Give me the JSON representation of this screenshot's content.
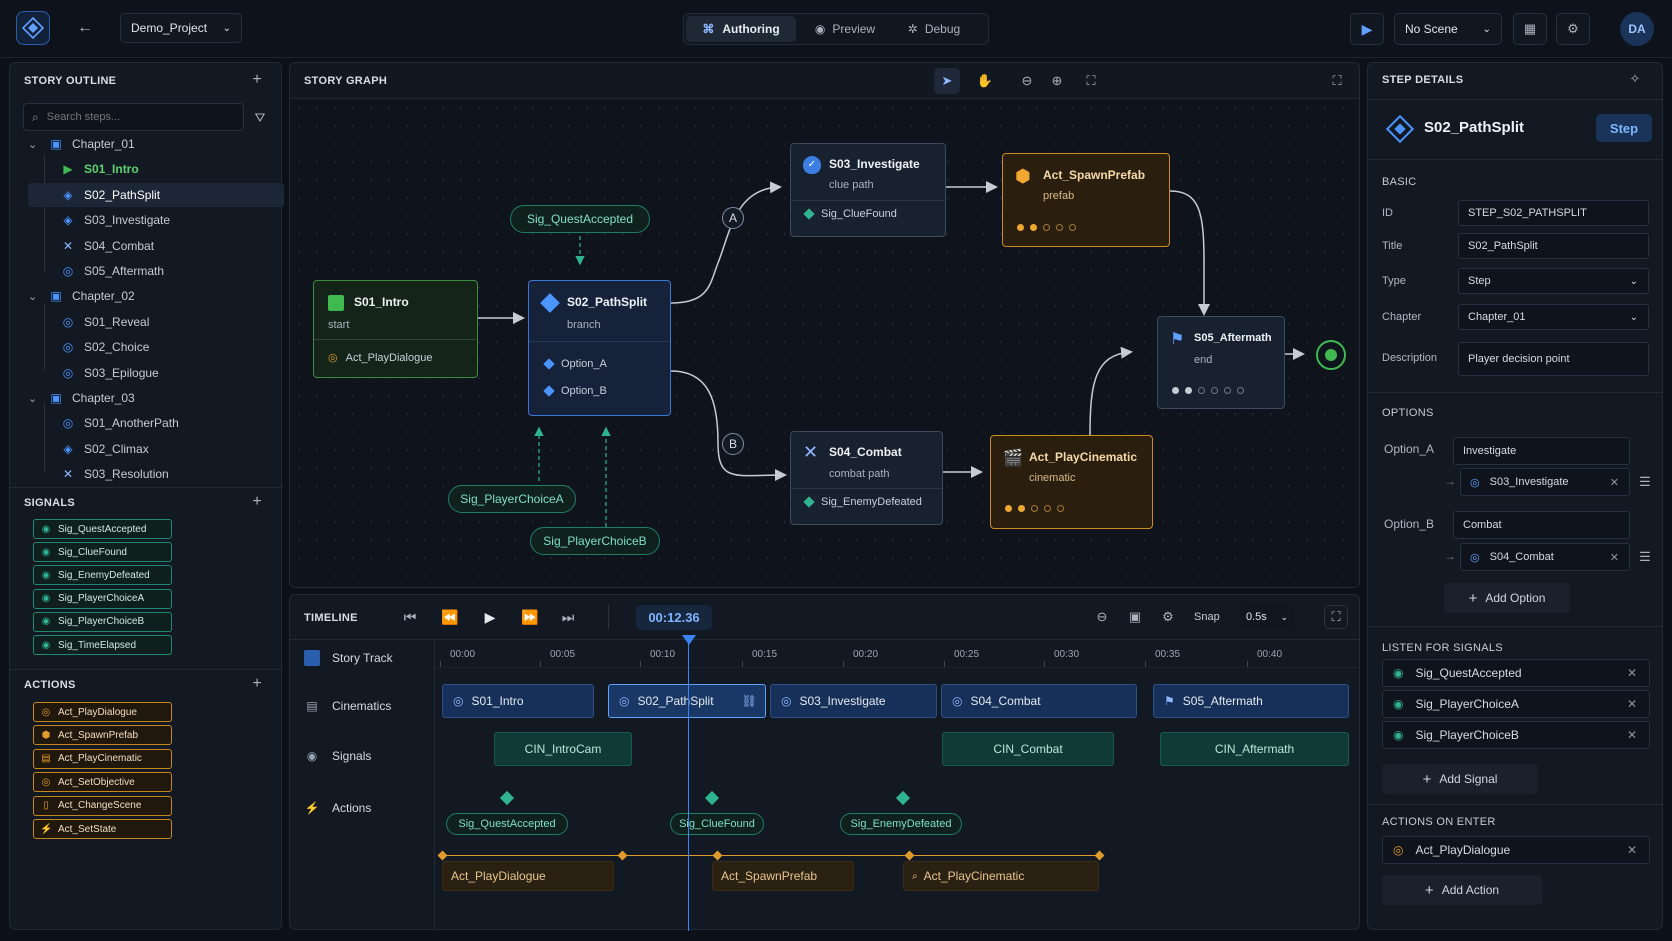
{
  "topbar": {
    "project": "Demo_Project",
    "modes": [
      "Authoring",
      "Preview",
      "Debug"
    ],
    "active_mode": "Authoring",
    "scene": "No Scene",
    "avatar": "DA"
  },
  "outline": {
    "title": "STORY OUTLINE",
    "search_placeholder": "Search steps...",
    "rows": [
      {
        "label": "Chapter_01",
        "kind": "chapter"
      },
      {
        "label": "S01_Intro",
        "kind": "start"
      },
      {
        "label": "S02_PathSplit",
        "kind": "branch",
        "selected": true
      },
      {
        "label": "S03_Investigate",
        "kind": "branch"
      },
      {
        "label": "S04_Combat",
        "kind": "combat"
      },
      {
        "label": "S05_Aftermath",
        "kind": "step"
      },
      {
        "label": "Chapter_02",
        "kind": "chapter"
      },
      {
        "label": "S01_Reveal",
        "kind": "step"
      },
      {
        "label": "S02_Choice",
        "kind": "step"
      },
      {
        "label": "S03_Epilogue",
        "kind": "step"
      },
      {
        "label": "Chapter_03",
        "kind": "chapter"
      },
      {
        "label": "S01_AnotherPath",
        "kind": "step"
      },
      {
        "label": "S02_Climax",
        "kind": "branch"
      },
      {
        "label": "S03_Resolution",
        "kind": "combat"
      }
    ]
  },
  "signals": {
    "title": "SIGNALS",
    "items": [
      "Sig_QuestAccepted",
      "Sig_ClueFound",
      "Sig_EnemyDefeated",
      "Sig_PlayerChoiceA",
      "Sig_PlayerChoiceB",
      "Sig_TimeElapsed"
    ]
  },
  "actions": {
    "title": "ACTIONS",
    "items": [
      "Act_PlayDialogue",
      "Act_SpawnPrefab",
      "Act_PlayCinematic",
      "Act_SetObjective",
      "Act_ChangeScene",
      "Act_SetState"
    ]
  },
  "graph": {
    "title": "STORY GRAPH",
    "nodes": {
      "intro": {
        "title": "S01_Intro",
        "sub": "start",
        "row": "Act_PlayDialogue"
      },
      "split": {
        "title": "S02_PathSplit",
        "sub": "branch",
        "opt_a": "Option_A",
        "opt_b": "Option_B"
      },
      "investigate": {
        "title": "S03_Investigate",
        "sub": "clue path",
        "row": "Sig_ClueFound"
      },
      "spawn": {
        "title": "Act_SpawnPrefab",
        "sub": "prefab"
      },
      "combat": {
        "title": "S04_Combat",
        "sub": "combat path",
        "row": "Sig_EnemyDefeated"
      },
      "cinematic": {
        "title": "Act_PlayCinematic",
        "sub": "cinematic"
      },
      "aftermath": {
        "title": "S05_Aftermath",
        "sub": "end"
      }
    },
    "signal_pills": [
      "Sig_QuestAccepted",
      "Sig_PlayerChoiceA",
      "Sig_PlayerChoiceB"
    ],
    "branch_labels": [
      "A",
      "B"
    ]
  },
  "timeline": {
    "title": "TIMELINE",
    "time": "00:12.36",
    "snap_label": "Snap",
    "snap_value": "0.5s",
    "ticks": [
      "00:00",
      "00:05",
      "00:10",
      "00:15",
      "00:20",
      "00:25",
      "00:30",
      "00:35",
      "00:40"
    ],
    "tracks": [
      "Story Track",
      "Cinematics",
      "Signals",
      "Actions"
    ],
    "story_clips": [
      "S01_Intro",
      "S02_PathSplit",
      "S03_Investigate",
      "S04_Combat",
      "S05_Aftermath"
    ],
    "cin_clips": [
      "CIN_IntroCam",
      "CIN_Combat",
      "CIN_Aftermath"
    ],
    "sig_clips": [
      "Sig_QuestAccepted",
      "Sig_ClueFound",
      "Sig_EnemyDefeated"
    ],
    "act_clips": [
      "Act_PlayDialogue",
      "Act_SpawnPrefab",
      "Act_PlayCinematic"
    ]
  },
  "details": {
    "title": "STEP DETAILS",
    "name": "S02_PathSplit",
    "badge": "Step",
    "basic_title": "BASIC",
    "fields": {
      "id_label": "ID",
      "id": "STEP_S02_PATHSPLIT",
      "title_label": "Title",
      "title": "S02_PathSplit",
      "type_label": "Type",
      "type": "Step",
      "chapter_label": "Chapter",
      "chapter": "Chapter_01",
      "desc_label": "Description",
      "desc": "Player decision point"
    },
    "options_title": "OPTIONS",
    "options": [
      {
        "label": "Option_A",
        "value": "Investigate",
        "target": "S03_Investigate"
      },
      {
        "label": "Option_B",
        "value": "Combat",
        "target": "S04_Combat"
      }
    ],
    "add_option": "Add Option",
    "listen_title": "LISTEN FOR SIGNALS",
    "listen": [
      "Sig_QuestAccepted",
      "Sig_PlayerChoiceA",
      "Sig_PlayerChoiceB"
    ],
    "add_signal": "Add Signal",
    "actions_title": "ACTIONS ON ENTER",
    "on_enter": [
      "Act_PlayDialogue"
    ],
    "add_action": "Add Action"
  },
  "colors": {
    "accent": "#3b82f6",
    "signal": "#1fa386",
    "action": "#e19b2c",
    "start": "#3fb950"
  }
}
